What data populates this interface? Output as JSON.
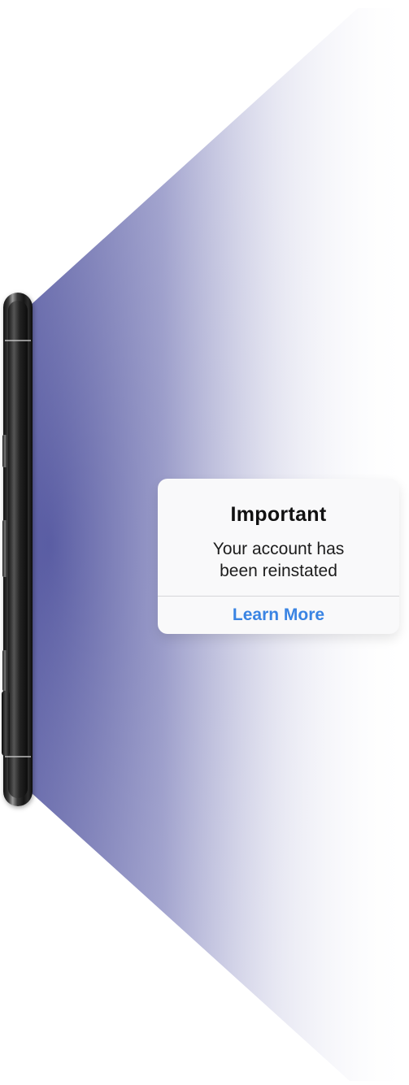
{
  "notification": {
    "title": "Important",
    "message_line1": "Your account has",
    "message_line2": "been reinstated",
    "action_label": "Learn More"
  },
  "colors": {
    "beam": "#5d60a6",
    "action": "#3a84e3",
    "card": "#f9f9fa"
  }
}
